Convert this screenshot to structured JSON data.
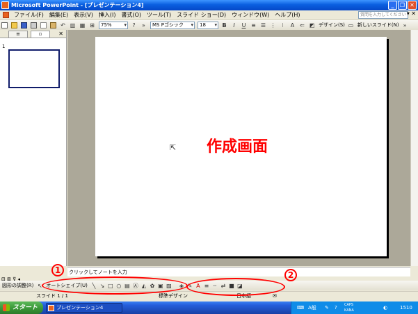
{
  "window": {
    "title": "Microsoft PowerPoint - [プレゼンテーション4]"
  },
  "menubar": {
    "items": [
      "ファイル(F)",
      "編集(E)",
      "表示(V)",
      "挿入(I)",
      "書式(O)",
      "ツール(T)",
      "スライド ショー(D)",
      "ウィンドウ(W)",
      "ヘルプ(H)"
    ],
    "help_placeholder": "質問を入力してください"
  },
  "toolbar": {
    "zoom": "75%",
    "font": "MS Pゴシック",
    "font_size": "18",
    "bold": "B",
    "italic": "I",
    "underline": "U",
    "design_button": "デザイン(S)",
    "new_slide_button": "新しいスライド(N)"
  },
  "left_pane": {
    "slide_number": "1"
  },
  "slide": {
    "label": "作成画面"
  },
  "notes": {
    "placeholder": "クリックしてノートを入力"
  },
  "drawbar": {
    "draw_menu": "図形の調整(R)",
    "autoshape_menu": "オートシェイプ(U)"
  },
  "statusbar": {
    "slide_position": "スライド 1 / 1",
    "design": "標準デザイン",
    "language": "日本語"
  },
  "taskbar": {
    "start": "スタート",
    "task_item": "プレゼンテーション4",
    "ime": "A般",
    "caps": "CAPS",
    "kana": "KANA",
    "clock": "1510"
  },
  "annotations": {
    "marker_1": "1",
    "marker_2": "2",
    "color": "#ff0000"
  },
  "colors": {
    "title_bar": "#0a5fe0",
    "slide_label": "#ff0000",
    "workspace": "#aca899"
  }
}
